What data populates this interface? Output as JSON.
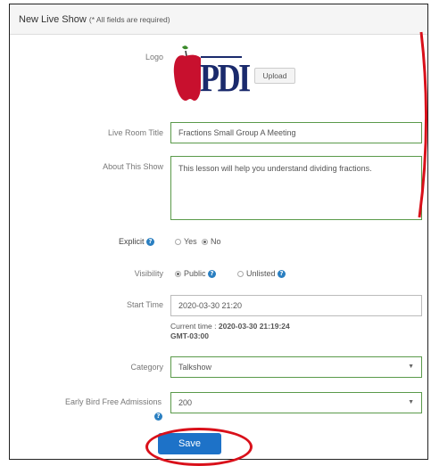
{
  "header": {
    "title": "New Live Show",
    "note": "(* All fields are required)"
  },
  "logo": {
    "label": "Logo",
    "brand_text": "PDI",
    "upload_label": "Upload"
  },
  "live_room_title": {
    "label": "Live Room Title",
    "value": "Fractions Small Group A Meeting"
  },
  "about": {
    "label": "About This Show",
    "value": "This lesson will help you understand dividing fractions."
  },
  "explicit": {
    "label": "Explicit",
    "options": [
      "Yes",
      "No"
    ],
    "selected": "No"
  },
  "visibility": {
    "label": "Visibility",
    "options": [
      "Public",
      "Unlisted"
    ],
    "selected": "Public"
  },
  "start_time": {
    "label": "Start Time",
    "value": "2020-03-30 21:20",
    "current_label": "Current time : ",
    "current_value": "2020-03-30 21:19:24",
    "timezone": "GMT-03:00"
  },
  "category": {
    "label": "Category",
    "value": "Talkshow"
  },
  "early_bird": {
    "label": "Early Bird Free Admissions",
    "value": "200"
  },
  "save_label": "Save",
  "colors": {
    "accent": "#1d72c8",
    "field_border": "#5a9a4a",
    "annotation": "#d9101a",
    "logo_red": "#c8102e",
    "logo_navy": "#1a2a6c"
  },
  "icons": [
    "help-icon",
    "apple-logo-icon",
    "caret-down-icon"
  ]
}
